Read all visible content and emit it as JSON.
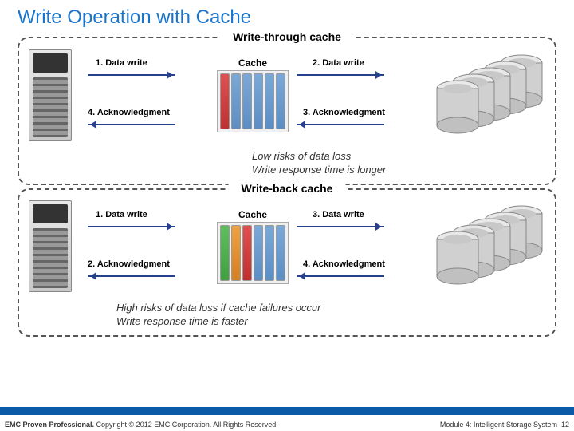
{
  "title": "Write Operation with Cache",
  "sections": {
    "wt": {
      "label": "Write-through cache",
      "cache_label": "Cache",
      "steps": {
        "s1": "1. Data write",
        "s2": "2. Data write",
        "s3": "3. Acknowledgment",
        "s4": "4. Acknowledgment"
      },
      "summary1": "Low risks of data loss",
      "summary2": "Write response time is longer"
    },
    "wb": {
      "label": "Write-back cache",
      "cache_label": "Cache",
      "steps": {
        "s1": "1. Data write",
        "s2": "2. Acknowledgment",
        "s3": "3. Data write",
        "s4": "4. Acknowledgment"
      },
      "summary1": "High risks of data loss if cache failures occur",
      "summary2": "Write response time is faster"
    }
  },
  "footer": {
    "brand": "EMC Proven Professional.",
    "copyright": " Copyright © 2012 EMC Corporation. All Rights Reserved.",
    "module": "Module 4: Intelligent Storage System",
    "page": "12"
  }
}
